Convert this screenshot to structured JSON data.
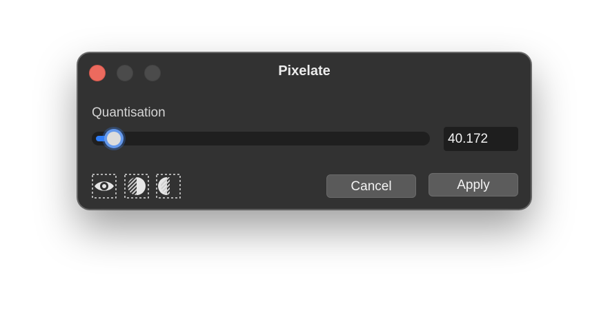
{
  "window": {
    "title": "Pixelate",
    "close_icon": "close-dot-icon",
    "minimize_icon": "minimize-dot-icon",
    "zoom_icon": "zoom-dot-icon"
  },
  "quantisation": {
    "label": "Quantisation",
    "value": "40.172",
    "slider_fraction": 0.04
  },
  "view_modes": [
    {
      "icon": "eye-icon",
      "meaning": "preview"
    },
    {
      "icon": "split-compare-icon",
      "meaning": "split"
    },
    {
      "icon": "side-by-side-compare-icon",
      "meaning": "mirrored split"
    }
  ],
  "buttons": {
    "cancel_label": "Cancel",
    "apply_label": "Apply"
  },
  "colors": {
    "window_bg": "#323232",
    "close": "#ec6a5e",
    "accent": "#2f7df6"
  }
}
